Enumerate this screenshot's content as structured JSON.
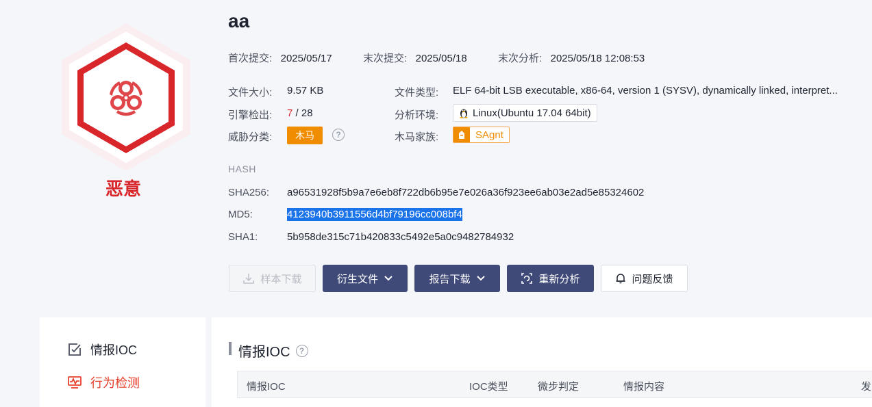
{
  "sample": {
    "title": "aa",
    "verdict": "恶意",
    "meta": [
      {
        "label": "首次提交:",
        "value": "2025/05/17"
      },
      {
        "label": "末次提交:",
        "value": "2025/05/18"
      },
      {
        "label": "末次分析:",
        "value": "2025/05/18 12:08:53"
      }
    ],
    "file_size_label": "文件大小:",
    "file_size": "9.57 KB",
    "file_type_label": "文件类型:",
    "file_type": "ELF 64-bit LSB executable, x86-64, version 1 (SYSV), dynamically linked, interpret...",
    "engine_label": "引擎检出:",
    "engine_hits": "7",
    "engine_total": "/ 28",
    "env_label": "分析环境:",
    "env": "Linux(Ubuntu 17.04 64bit)",
    "threat_label": "威胁分类:",
    "threat_tag": "木马",
    "family_label": "木马家族:",
    "family": "SAgnt"
  },
  "hash": {
    "heading": "HASH",
    "sha256_label": "SHA256:",
    "sha256": "a96531928f5b9a7e6eb8f722db6b95e7e026a36f923ee6ab03e2ad5e85324602",
    "md5_label": "MD5:",
    "md5": "4123940b3911556d4bf79196cc008bf4",
    "sha1_label": "SHA1:",
    "sha1": "5b958de315c71b420833c5492e5a0c9482784932"
  },
  "actions": {
    "download_sample": "样本下载",
    "derived_files": "衍生文件",
    "report_download": "报告下载",
    "reanalyze": "重新分析",
    "feedback": "问题反馈"
  },
  "sidebar": {
    "items": [
      {
        "label": "情报IOC"
      },
      {
        "label": "行为检测"
      }
    ]
  },
  "section": {
    "title": "情报IOC",
    "columns": [
      "情报IOC",
      "IOC类型",
      "微步判定",
      "情报内容",
      "发"
    ]
  },
  "colors": {
    "malicious": "#d9262b",
    "accent_orange": "#f08c00",
    "button_dark": "#3f4a78"
  }
}
